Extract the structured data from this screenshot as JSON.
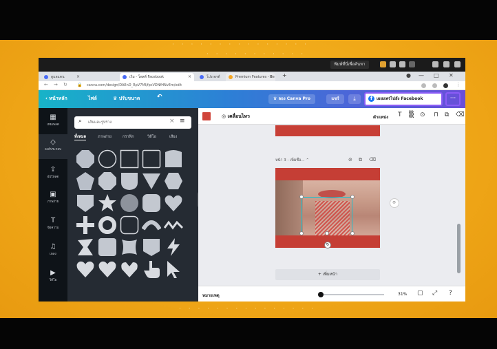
{
  "taskbar": {
    "search_label": "พิมพ์ที่นี่เพื่อค้นหา"
  },
  "browser": {
    "tabs": [
      {
        "label": "ดูแลแคน"
      },
      {
        "label": "เริ่ม - โพสต์ Facebook"
      },
      {
        "label": "โปรเจกต์"
      },
      {
        "label": "Premium Features - Be Free"
      }
    ],
    "url": "canva.com/design/DAEnD_RpV7MI/fpcVDNfHNvEm/edit",
    "win_controls": [
      "—",
      "□",
      "✕"
    ]
  },
  "canva_topbar": {
    "home": "หน้าหลัก",
    "file": "ไฟล์",
    "resize": "ปรับขนาด",
    "undo_icon": "undo-icon",
    "pro": "ลอง Canva Pro",
    "share": "แชร์",
    "download_icon": "download-icon",
    "facebook": "เผยแพร่ไปยัง Facebook",
    "more": "···"
  },
  "rail": [
    {
      "label": "เทมเพลต",
      "icon": "▦"
    },
    {
      "label": "องค์ประกอบ",
      "icon": "◇"
    },
    {
      "label": "อัปโหลด",
      "icon": "⇪"
    },
    {
      "label": "ภาพถ่าย",
      "icon": "▣"
    },
    {
      "label": "ข้อความ",
      "icon": "T"
    },
    {
      "label": "เพลง",
      "icon": "♫"
    },
    {
      "label": "วิดีโอ",
      "icon": "▶"
    }
  ],
  "panel": {
    "search_placeholder": "เส้นและรูปร่าง",
    "tabs": [
      "ทั้งหมด",
      "ภาพถ่าย",
      "กราฟิก",
      "วิดีโอ",
      "เสียง"
    ]
  },
  "canvas": {
    "swatch_color": "#d0453a",
    "animate": "เคลื่อนไหว",
    "position": "ตำแหน่ง",
    "page_label": "หน้า 3 - เพิ่มชื่อ...",
    "add_page": "+ เพิ่มหน้า",
    "notes": "หมายเหตุ",
    "zoom": "31%",
    "accent": "#c53e35"
  }
}
